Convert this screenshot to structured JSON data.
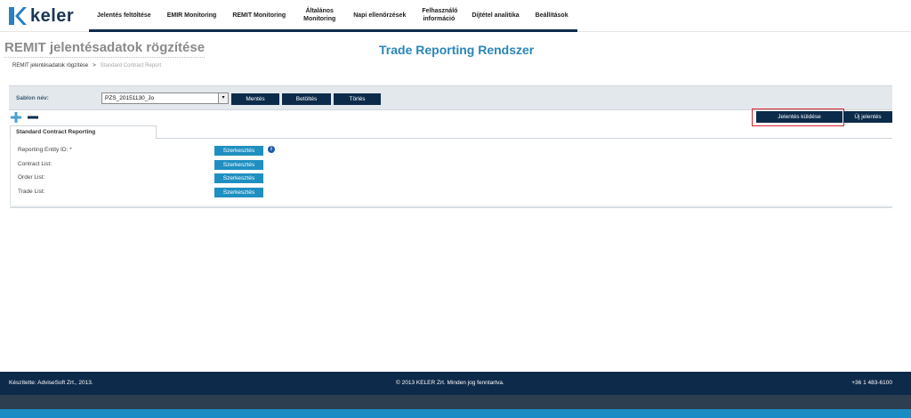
{
  "brand": {
    "name": "keler"
  },
  "nav": {
    "items": [
      {
        "label": "Jelentés feltöltése"
      },
      {
        "label": "EMIR Monitoring"
      },
      {
        "label": "REMIT Monitoring"
      },
      {
        "label": "Általános Monitoring"
      },
      {
        "label": "Napi ellenőrzések"
      },
      {
        "label": "Felhasználó információ"
      },
      {
        "label": "Díjtétel analitika"
      },
      {
        "label": "Beállítások"
      }
    ]
  },
  "page": {
    "title": "REMIT jelentésadatok rögzítése",
    "system_title": "Trade Reporting Rendszer"
  },
  "breadcrumb": {
    "root": "REMIT jelentésadatok rögzítése",
    "separator": ">",
    "current": "Standard Contract Report"
  },
  "template": {
    "label": "Sablon név:",
    "selected": "PZS_20151130_Jo",
    "save": "Mentés",
    "load": "Betöltés",
    "delete": "Törlés"
  },
  "actions": {
    "send_report": "Jelentés küldése",
    "new_report": "Új jelentés"
  },
  "tabs": {
    "active": "Standard Contract Reporting"
  },
  "fields": {
    "rows": [
      {
        "label": "Reporting Entity ID: *",
        "button": "Szerkesztés"
      },
      {
        "label": "Contract List:",
        "button": "Szerkesztés"
      },
      {
        "label": "Order List:",
        "button": "Szerkesztés"
      },
      {
        "label": "Trade List:",
        "button": "Szerkesztés"
      }
    ],
    "info_glyph": "i"
  },
  "footer": {
    "left": "Készítette: AdviseSoft Zrt., 2013.",
    "center": "© 2013 KELER Zrt. Minden jog fenntartva.",
    "right": "+36 1 483-6100"
  },
  "colors": {
    "navy": "#0c2b4b",
    "accent_blue": "#1f8fc1",
    "title_blue": "#2a86b9",
    "highlight_red": "#d8232a"
  },
  "icons": {
    "add": "plus-icon",
    "remove": "minus-icon",
    "info": "info-icon",
    "dropdown": "chevron-down-icon"
  }
}
